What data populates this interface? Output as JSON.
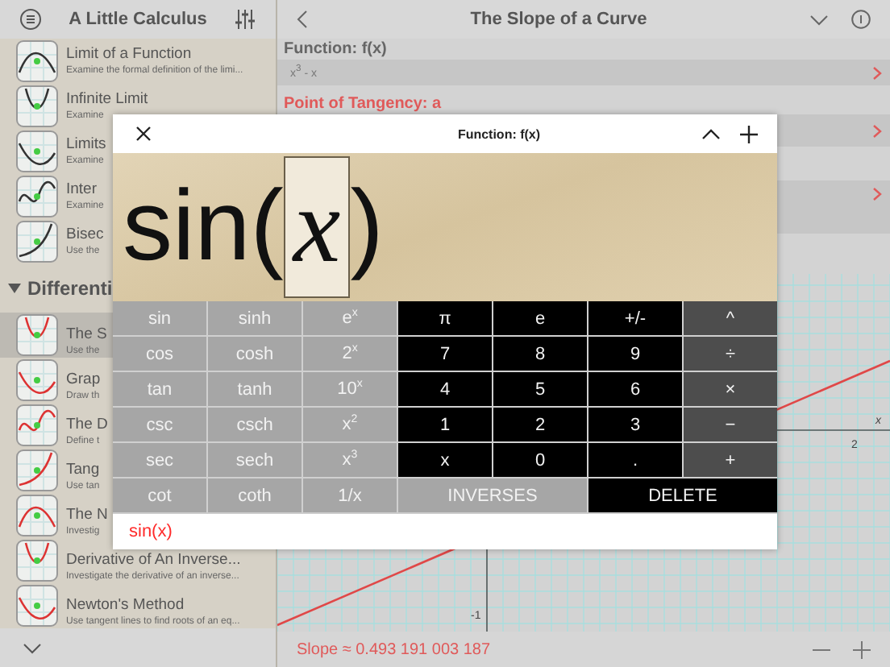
{
  "sidebar": {
    "title": "A Little Calculus",
    "items": [
      {
        "kind": "lesson",
        "title": "Limit of a Function",
        "subtitle": "Examine the formal definition of the limi...",
        "selected": false
      },
      {
        "kind": "lesson",
        "title": "Infinite Limit",
        "subtitle": "Examine",
        "selected": false
      },
      {
        "kind": "lesson",
        "title": "Limits",
        "subtitle": "Examine",
        "selected": false
      },
      {
        "kind": "lesson",
        "title": "Inter",
        "subtitle": "Examine",
        "selected": false
      },
      {
        "kind": "lesson",
        "title": "Bisec",
        "subtitle": "Use the",
        "selected": false
      },
      {
        "kind": "section",
        "title": "Differenti",
        "expanded": true
      },
      {
        "kind": "lesson",
        "title": "The S",
        "subtitle": "Use the",
        "selected": true
      },
      {
        "kind": "lesson",
        "title": "Grap",
        "subtitle": "Draw th",
        "selected": false
      },
      {
        "kind": "lesson",
        "title": "The D",
        "subtitle": "Define t",
        "selected": false
      },
      {
        "kind": "lesson",
        "title": "Tang",
        "subtitle": "Use tan",
        "selected": false
      },
      {
        "kind": "lesson",
        "title": "The N",
        "subtitle": "Investig",
        "selected": false
      },
      {
        "kind": "lesson",
        "title": "Derivative of An Inverse...",
        "subtitle": "Investigate the derivative of an inverse...",
        "selected": false
      },
      {
        "kind": "lesson",
        "title": "Newton's Method",
        "subtitle": "Use tangent lines to find roots of an eq...",
        "selected": false
      }
    ]
  },
  "detail": {
    "title": "The Slope of a Curve",
    "function_label": "Function: f(x)",
    "function_value": "x$^{3}$ - x",
    "tangency_label": "Point of Tangency: a",
    "graph_labels": [
      {
        "kind": "x_tick",
        "text": "2"
      },
      {
        "kind": "x_axis",
        "text": "x"
      },
      {
        "kind": "y_tick",
        "text": "-1"
      }
    ],
    "status": "Slope ≈ 0.493 191 003 187"
  },
  "editor": {
    "title": "Function: f(x)",
    "display": {
      "before": "sin(",
      "cursor": "x",
      "after": ")"
    },
    "keys": [
      {
        "label": "sin",
        "kind": "fn"
      },
      {
        "label": "sinh",
        "kind": "fn"
      },
      {
        "label": "e$^{x}$",
        "kind": "fn"
      },
      {
        "label": "π",
        "kind": "num"
      },
      {
        "label": "e",
        "kind": "num"
      },
      {
        "label": "+/-",
        "kind": "num"
      },
      {
        "label": "^",
        "kind": "op"
      },
      {
        "label": "cos",
        "kind": "fn"
      },
      {
        "label": "cosh",
        "kind": "fn"
      },
      {
        "label": "2$^{x}$",
        "kind": "fn"
      },
      {
        "label": "7",
        "kind": "num"
      },
      {
        "label": "8",
        "kind": "num"
      },
      {
        "label": "9",
        "kind": "num"
      },
      {
        "label": "÷",
        "kind": "op"
      },
      {
        "label": "tan",
        "kind": "fn"
      },
      {
        "label": "tanh",
        "kind": "fn"
      },
      {
        "label": "10$^{x}$",
        "kind": "fn"
      },
      {
        "label": "4",
        "kind": "num"
      },
      {
        "label": "5",
        "kind": "num"
      },
      {
        "label": "6",
        "kind": "num"
      },
      {
        "label": "×",
        "kind": "op"
      },
      {
        "label": "csc",
        "kind": "fn"
      },
      {
        "label": "csch",
        "kind": "fn"
      },
      {
        "label": "x$^{2}$",
        "kind": "fn"
      },
      {
        "label": "1",
        "kind": "num"
      },
      {
        "label": "2",
        "kind": "num"
      },
      {
        "label": "3",
        "kind": "num"
      },
      {
        "label": "−",
        "kind": "op"
      },
      {
        "label": "sec",
        "kind": "fn"
      },
      {
        "label": "sech",
        "kind": "fn"
      },
      {
        "label": "x$^{3}$",
        "kind": "fn"
      },
      {
        "label": "x",
        "kind": "num"
      },
      {
        "label": "0",
        "kind": "num"
      },
      {
        "label": ".",
        "kind": "num"
      },
      {
        "label": "+",
        "kind": "op"
      },
      {
        "label": "cot",
        "kind": "fn"
      },
      {
        "label": "coth",
        "kind": "fn"
      },
      {
        "label": "1/x",
        "kind": "fn"
      },
      {
        "label": "INVERSES",
        "kind": "wide_fn"
      },
      {
        "label": "DELETE",
        "kind": "wide_num"
      }
    ],
    "input": "sin(x)"
  }
}
